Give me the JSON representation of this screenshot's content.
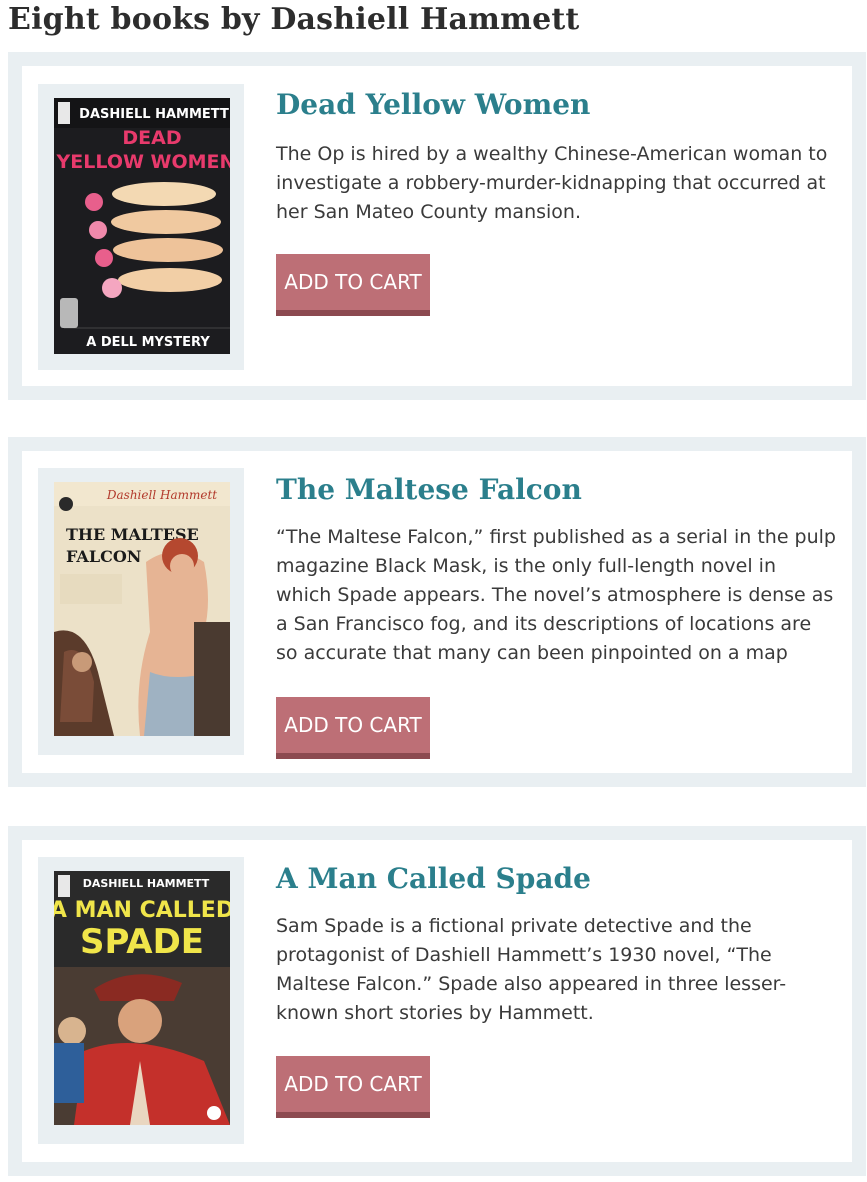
{
  "page": {
    "title": "Eight books by Dashiell Hammett"
  },
  "books": [
    {
      "title": "Dead Yellow Women",
      "description": "The Op is hired by a wealthy Chinese-American woman to investigate a robbery-murder-kidnapping that occurred at her San Mateo County mansion.",
      "button_label": "ADD TO CART",
      "cover": {
        "author": "DASHIELL HAMMETT",
        "title_line1": "DEAD",
        "title_line2": "YELLOW WOMEN",
        "footer": "A DELL MYSTERY"
      }
    },
    {
      "title": "The Maltese Falcon",
      "description": "“The Maltese Falcon,” first published as a serial in the pulp magazine Black Mask, is the only full-length novel in which Spade appears. The novel’s atmosphere is dense as a San Francisco fog, and its descriptions of locations are so accurate that many can been pinpointed on a map",
      "button_label": "ADD TO CART",
      "cover": {
        "author": "Dashiell Hammett",
        "title_line1": "THE MALTESE",
        "title_line2": "FALCON"
      }
    },
    {
      "title": "A Man Called Spade",
      "description": "Sam Spade is a fictional private detective and the protagonist of Dashiell Hammett’s 1930 novel, “The Maltese Falcon.” Spade also appeared in three lesser-known short stories by Hammett.",
      "button_label": "ADD TO CART",
      "cover": {
        "author": "DASHIELL HAMMETT",
        "title_line1": "A MAN CALLED",
        "title_line2": "SPADE"
      }
    }
  ]
}
